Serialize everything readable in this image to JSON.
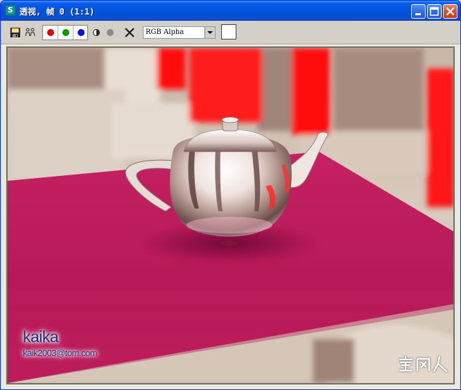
{
  "window": {
    "icon_letter": "S",
    "title": "透视, 帧 0 (1:1)"
  },
  "toolbar": {
    "channel_select_value": "RGB Alpha",
    "channel_options": [
      "RGB Alpha"
    ],
    "icons": [
      "save-icon",
      "clone-icon",
      "red-channel-icon",
      "green-channel-icon",
      "blue-channel-icon",
      "monochrome-icon",
      "alpha-gray-icon",
      "clear-icon",
      "chevron-down-icon"
    ],
    "channel_colors": {
      "red": "#e00000",
      "green": "#009a00",
      "blue": "#0010e0",
      "alpha": "#8c8c8c"
    },
    "swatch_color": "#ffffff"
  },
  "render": {
    "description_colors": {
      "tablecloth": "#c01c5c",
      "curtain": "#ff0000",
      "background": "#bfa99b"
    },
    "watermark": {
      "name": "kaika",
      "email": "kaik2003@tom.com"
    },
    "signature_text": "室内人"
  },
  "colors": {
    "title_bar": "#0454e1",
    "window_bg": "#d4d0c8",
    "accent_text": "#1c2f74"
  }
}
